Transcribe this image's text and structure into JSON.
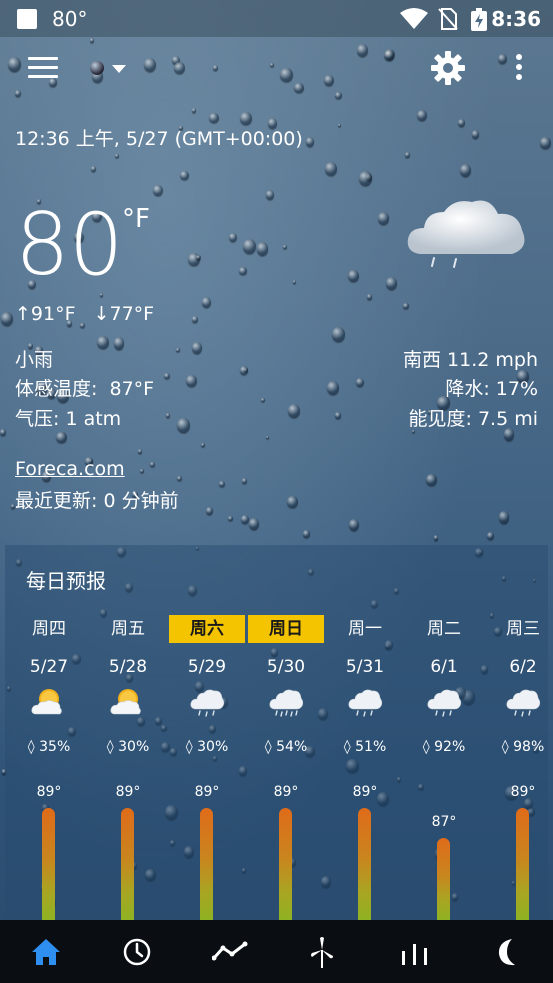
{
  "status_bar": {
    "temp": "80°",
    "time": "8:36"
  },
  "toolbar": {
    "location_placeholder_dot": ""
  },
  "current": {
    "datetime": "12:36 上午, 5/27 (GMT+00:00)",
    "temperature": "80",
    "unit": "°F",
    "high": "91°F",
    "low": "77°F",
    "condition": "小雨",
    "feels_like_label": "体感温度:",
    "feels_like": "87°F",
    "pressure": "气压: 1 atm",
    "wind": "南西 11.2 mph",
    "precip": "降水: 17%",
    "visibility": "能见度: 7.5 mi"
  },
  "source": {
    "link": "Foreca.com",
    "updated": "最近更新:  0 分钟前"
  },
  "forecast": {
    "title": "每日预报",
    "days": [
      {
        "name": "周四",
        "date": "5/27",
        "icon": "partly-cloudy-sun-icon",
        "precip": "35%",
        "high": "89°",
        "high_value": 89,
        "selected": false
      },
      {
        "name": "周五",
        "date": "5/28",
        "icon": "partly-cloudy-sun-icon",
        "precip": "30%",
        "high": "89°",
        "high_value": 89,
        "selected": false
      },
      {
        "name": "周六",
        "date": "5/29",
        "icon": "cloud-light-rain-icon",
        "precip": "30%",
        "high": "89°",
        "high_value": 89,
        "selected": true
      },
      {
        "name": "周日",
        "date": "5/30",
        "icon": "cloud-rain-icon",
        "precip": "54%",
        "high": "89°",
        "high_value": 89,
        "selected": true
      },
      {
        "name": "周一",
        "date": "5/31",
        "icon": "cloud-light-rain-icon",
        "precip": "51%",
        "high": "89°",
        "high_value": 89,
        "selected": false
      },
      {
        "name": "周二",
        "date": "6/1",
        "icon": "cloud-light-rain-icon",
        "precip": "92%",
        "high": "87°",
        "high_value": 87,
        "selected": false
      },
      {
        "name": "周三",
        "date": "6/2",
        "icon": "cloud-light-rain-icon",
        "precip": "98%",
        "high": "89°",
        "high_value": 89,
        "selected": false
      }
    ]
  },
  "nav": {
    "items": [
      "home-icon",
      "clock-icon",
      "trend-icon",
      "wind-turbine-icon",
      "bar-chart-icon",
      "moon-icon"
    ],
    "active_color": "#2f8ff0"
  }
}
